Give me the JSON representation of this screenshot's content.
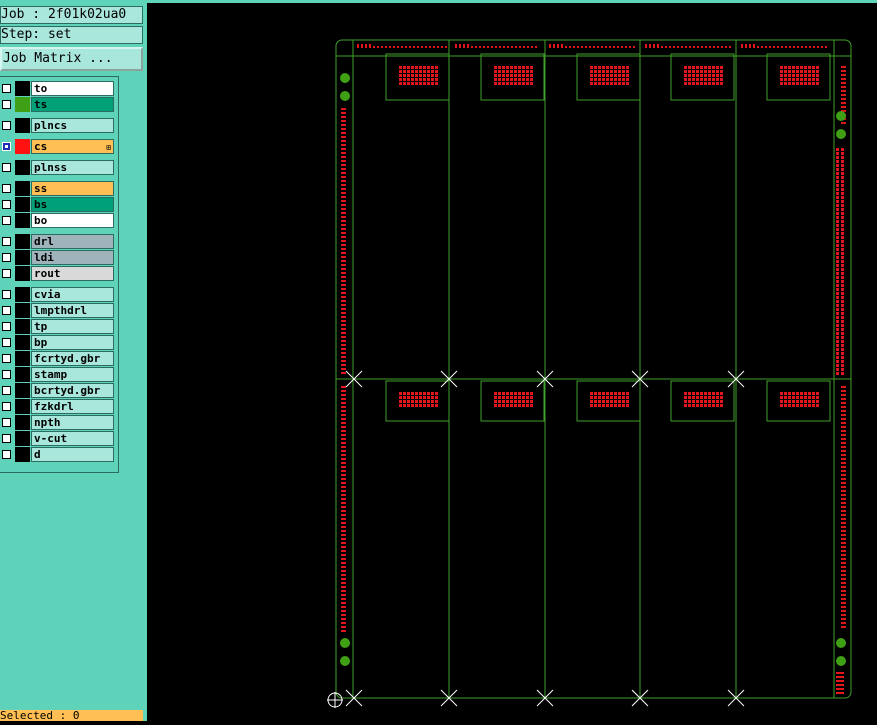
{
  "header": {
    "job": "Job : 2f01k02ua0",
    "step": "Step: set",
    "job_matrix_button": "Job Matrix ..."
  },
  "layers": [
    {
      "name": "to",
      "bg": "#ffffff",
      "swatch": "#000000",
      "checked": false
    },
    {
      "name": "ts",
      "bg": "#00a078",
      "swatch": "#3f9f15",
      "checked": false
    },
    {
      "name": "plncs",
      "bg": "#a9e6dc",
      "swatch": "#000000",
      "checked": false
    },
    {
      "name": "cs",
      "bg": "#ffbf54",
      "swatch": "#ff1111",
      "checked": true,
      "selected": true,
      "marker": "⊞"
    },
    {
      "name": "plnss",
      "bg": "#a9e6dc",
      "swatch": "#000000",
      "checked": false
    },
    {
      "name": "ss",
      "bg": "#ffbf54",
      "swatch": "#000000",
      "checked": false
    },
    {
      "name": "bs",
      "bg": "#00a078",
      "swatch": "#000000",
      "checked": false
    },
    {
      "name": "bo",
      "bg": "#ffffff",
      "swatch": "#000000",
      "checked": false
    },
    {
      "name": "drl",
      "bg": "#9fb3ba",
      "swatch": "#000000",
      "checked": false
    },
    {
      "name": "ldi",
      "bg": "#9fb3ba",
      "swatch": "#000000",
      "checked": false
    },
    {
      "name": "rout",
      "bg": "#d9d9d9",
      "swatch": "#000000",
      "checked": false
    },
    {
      "name": "cvia",
      "bg": "#a9e6dc",
      "swatch": "#000000",
      "checked": false
    },
    {
      "name": "lmpthdrl",
      "bg": "#a9e6dc",
      "swatch": "#000000",
      "checked": false
    },
    {
      "name": "tp",
      "bg": "#a9e6dc",
      "swatch": "#000000",
      "checked": false
    },
    {
      "name": "bp",
      "bg": "#a9e6dc",
      "swatch": "#000000",
      "checked": false
    },
    {
      "name": "fcrtyd.gbr",
      "bg": "#a9e6dc",
      "swatch": "#000000",
      "checked": false
    },
    {
      "name": "stamp",
      "bg": "#a9e6dc",
      "swatch": "#000000",
      "checked": false
    },
    {
      "name": "bcrtyd.gbr",
      "bg": "#a9e6dc",
      "swatch": "#000000",
      "checked": false
    },
    {
      "name": "fzkdrl",
      "bg": "#a9e6dc",
      "swatch": "#000000",
      "checked": false
    },
    {
      "name": "npth",
      "bg": "#a9e6dc",
      "swatch": "#000000",
      "checked": false
    },
    {
      "name": "v-cut",
      "bg": "#a9e6dc",
      "swatch": "#000000",
      "checked": false
    },
    {
      "name": "d",
      "bg": "#a9e6dc",
      "swatch": "#000000",
      "checked": false
    }
  ],
  "status": {
    "text": "Selected : 0"
  },
  "colors": {
    "outline": "#3fa02a",
    "pads": "#e0161c",
    "fiducial": "#3f9f15",
    "marker": "#ffffff"
  }
}
